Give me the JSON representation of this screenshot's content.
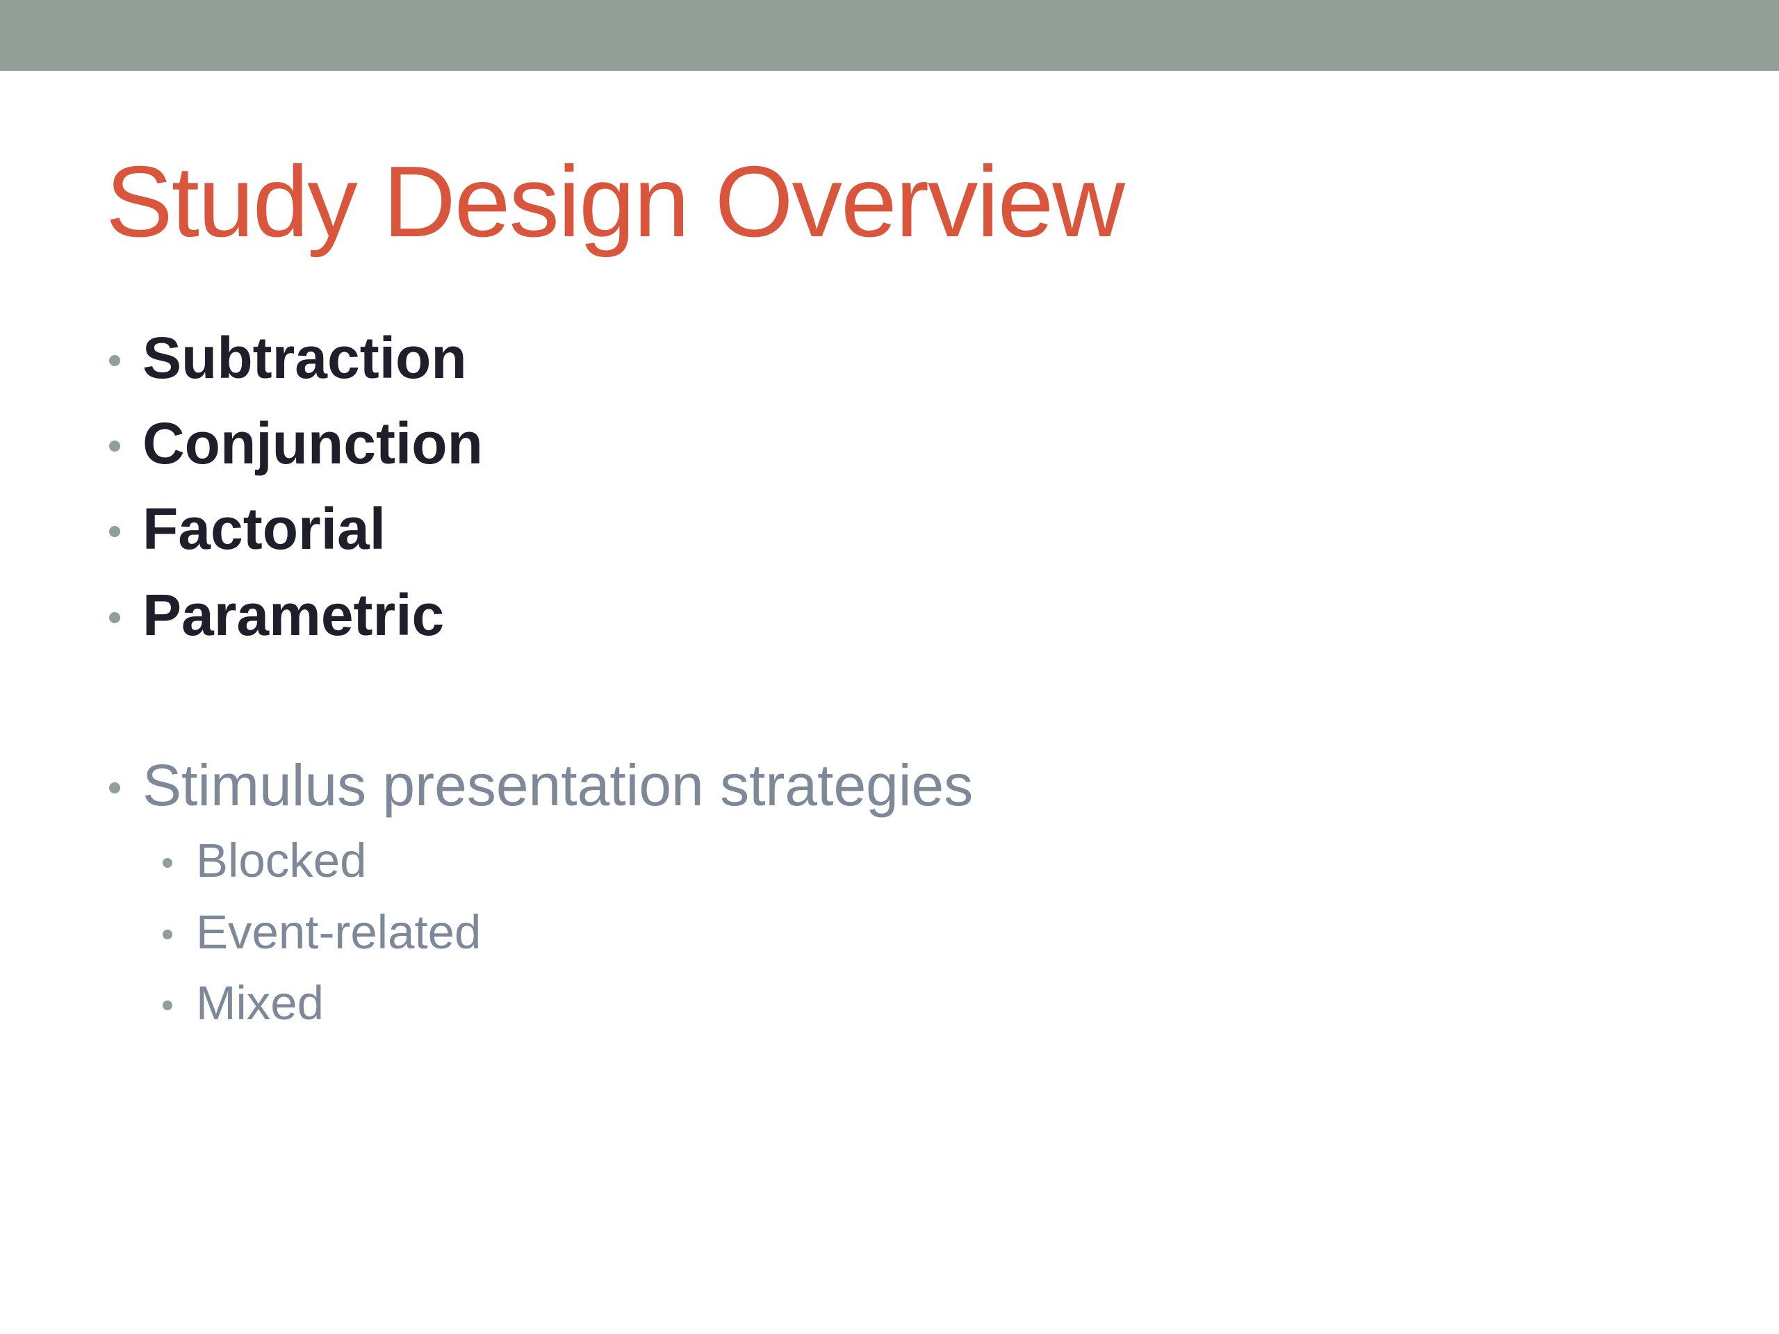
{
  "colors": {
    "top_bar": "#919f98",
    "title": "#d9553c",
    "bold_text": "#1e1f2a",
    "light_text": "#7d8898",
    "bullet": "#919f98"
  },
  "slide": {
    "title": "Study Design Overview",
    "design_types": [
      "Subtraction",
      "Conjunction",
      "Factorial",
      "Parametric"
    ],
    "presentation": {
      "label": "Stimulus presentation strategies",
      "items": [
        "Blocked",
        "Event-related",
        "Mixed"
      ]
    }
  }
}
